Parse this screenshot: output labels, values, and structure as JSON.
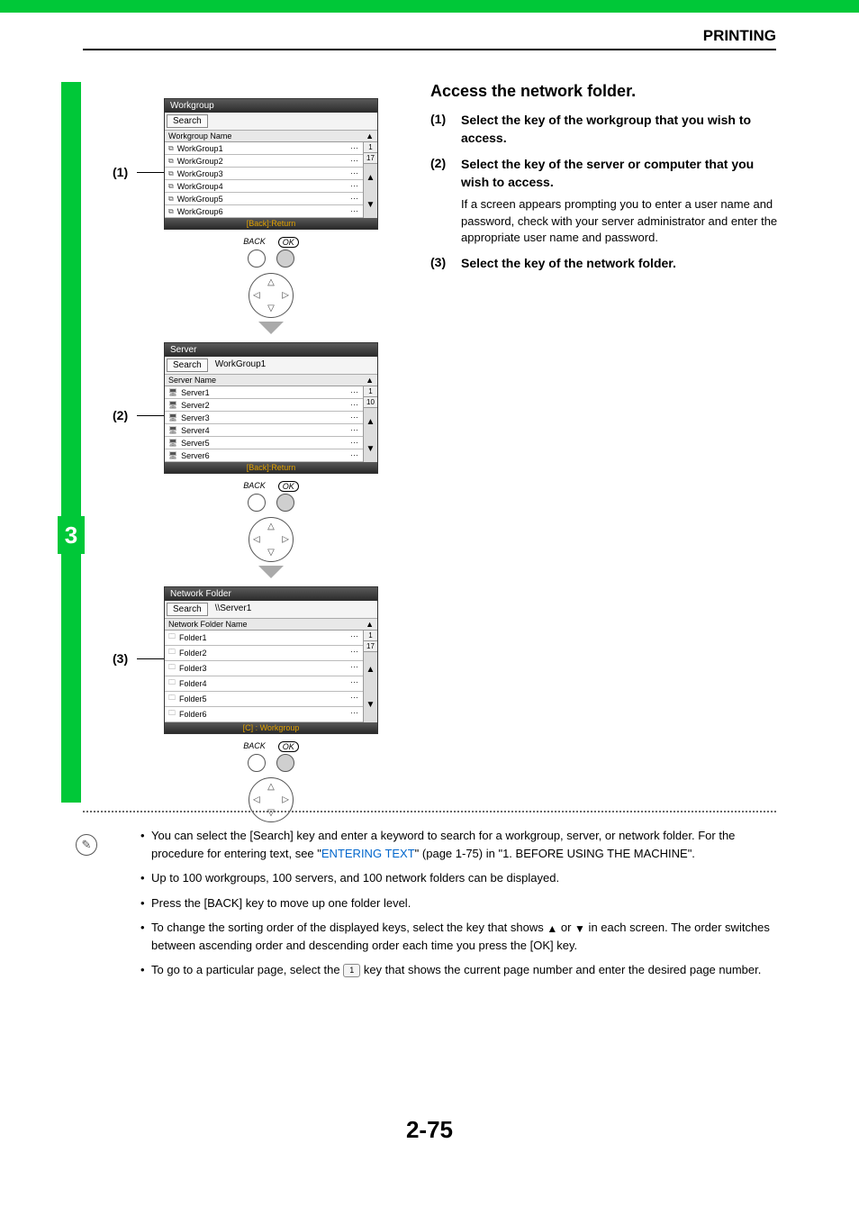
{
  "header": {
    "section": "PRINTING"
  },
  "stepBadge": "3",
  "callouts": {
    "c1": "(1)",
    "c2": "(2)",
    "c3": "(3)"
  },
  "panels": {
    "workgroup": {
      "title": "Workgroup",
      "search": "Search",
      "path": "",
      "columnHeader": "Workgroup Name",
      "rows": [
        "WorkGroup1",
        "WorkGroup2",
        "WorkGroup3",
        "WorkGroup4",
        "WorkGroup5",
        "WorkGroup6"
      ],
      "pageCurrent": "1",
      "pageTotal": "17",
      "footer": "[Back]:Return"
    },
    "server": {
      "title": "Server",
      "search": "Search",
      "path": "WorkGroup1",
      "columnHeader": "Server Name",
      "rows": [
        "Server1",
        "Server2",
        "Server3",
        "Server4",
        "Server5",
        "Server6"
      ],
      "pageCurrent": "1",
      "pageTotal": "10",
      "footer": "[Back]:Return"
    },
    "folder": {
      "title": "Network Folder",
      "search": "Search",
      "path": "\\\\Server1",
      "columnHeader": "Network Folder Name",
      "rows": [
        "Folder1",
        "Folder2",
        "Folder3",
        "Folder4",
        "Folder5",
        "Folder6"
      ],
      "pageCurrent": "1",
      "pageTotal": "17",
      "footer": "[C] : Workgroup"
    }
  },
  "nav": {
    "back": "BACK",
    "ok": "OK"
  },
  "right": {
    "title": "Access the network folder.",
    "steps": {
      "s1": {
        "num": "(1)",
        "text": "Select the key of the workgroup that you wish to access."
      },
      "s2": {
        "num": "(2)",
        "text": "Select the key of the server or computer that you wish to access.",
        "note": "If a screen appears prompting you to enter a user name and password, check with your server administrator and enter the appropriate user name and password."
      },
      "s3": {
        "num": "(3)",
        "text": "Select the key of the network folder."
      }
    }
  },
  "notes": {
    "n1a": "You can select the [Search] key and enter a keyword to search for a workgroup, server, or network folder. For the procedure for entering text, see \"",
    "n1link": "ENTERING TEXT",
    "n1b": "\" (page 1-75) in \"1. BEFORE USING THE MACHINE\".",
    "n2": "Up to 100 workgroups, 100 servers, and 100 network folders can be displayed.",
    "n3": "Press the [BACK] key to move up one folder level.",
    "n4a": "To change the sorting order of the displayed keys, select the key that shows ",
    "n4b": " or ",
    "n4c": " in each screen. The order switches between ascending order and descending order each time you press the [OK] key.",
    "n5a": "To go to a particular page, select the ",
    "n5key": "1",
    "n5b": " key that shows the current page number and enter the desired page number."
  },
  "pageNumber": "2-75"
}
